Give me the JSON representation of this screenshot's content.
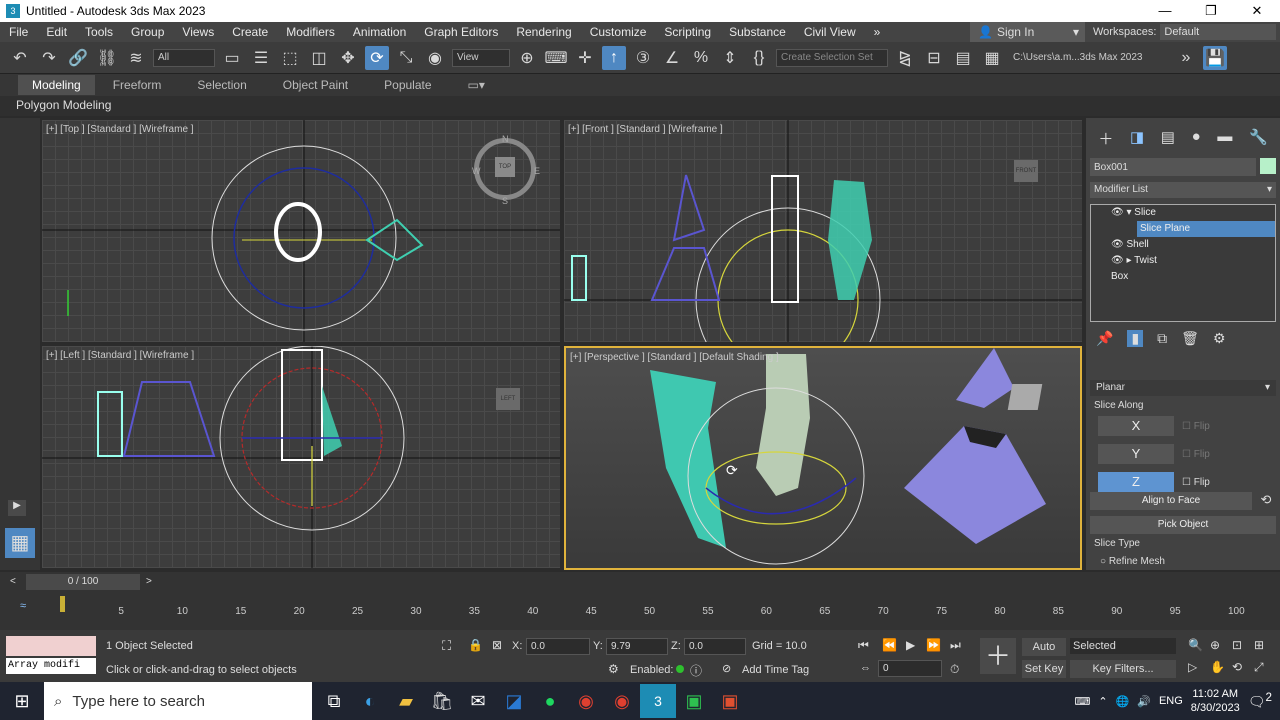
{
  "window": {
    "title": "Untitled - Autodesk 3ds Max 2023",
    "min": "—",
    "max": "❐",
    "close": "✕",
    "app_icon": "3"
  },
  "menu": {
    "items": [
      "File",
      "Edit",
      "Tools",
      "Group",
      "Views",
      "Create",
      "Modifiers",
      "Animation",
      "Graph Editors",
      "Rendering",
      "Customize",
      "Scripting",
      "Substance",
      "Civil View"
    ],
    "overflow": "»",
    "signin": "Sign In",
    "workspaces_label": "Workspaces:",
    "workspaces_value": "Default"
  },
  "toolbar": {
    "filter": "All",
    "coord": "View",
    "selection_set": "Create Selection Set",
    "path": "C:\\Users\\a.m...3ds Max 2023"
  },
  "ribbon": {
    "tabs": [
      "Modeling",
      "Freeform",
      "Selection",
      "Object Paint",
      "Populate"
    ],
    "active": "Modeling",
    "sub": "Polygon Modeling"
  },
  "viewports": {
    "top": "[+] [Top ] [Standard ] [Wireframe ]",
    "front": "[+] [Front ] [Standard ] [Wireframe ]",
    "left": "[+] [Left ] [Standard ] [Wireframe ]",
    "persp": "[+] [Perspective ] [Standard ] [Default Shading ]",
    "compass": {
      "n": "N",
      "s": "S",
      "e": "E",
      "w": "W"
    },
    "cube_top": "TOP",
    "cube_front": "FRONT",
    "cube_left": "LEFT"
  },
  "command_panel": {
    "object_name": "Box001",
    "modifier_list": "Modifier List",
    "stack": [
      "Slice",
      "Slice Plane",
      "Shell",
      "Twist",
      "Box"
    ],
    "dropdown": "Planar",
    "slice_along_label": "Slice Along",
    "axes": [
      "X",
      "Y",
      "Z"
    ],
    "active_axis": "Z",
    "flip": "Flip",
    "align_to_face": "Align to Face",
    "pick_object": "Pick Object",
    "slice_type_label": "Slice Type",
    "refine_mesh": "Refine Mesh"
  },
  "timeline": {
    "frame": "0 / 100",
    "ticks": [
      "0",
      "5",
      "10",
      "15",
      "20",
      "25",
      "30",
      "35",
      "40",
      "45",
      "50",
      "55",
      "60",
      "65",
      "70",
      "75",
      "80",
      "85",
      "90",
      "95",
      "100"
    ]
  },
  "status": {
    "maxscript": "Array modifi",
    "selected": "1 Object Selected",
    "prompt": "Click or click-and-drag to select objects",
    "x_label": "X:",
    "x": "0.0",
    "y_label": "Y:",
    "y": "9.79",
    "z_label": "Z:",
    "z": "0.0",
    "grid": "Grid = 10.0",
    "enabled": "Enabled:",
    "add_time_tag": "Add Time Tag",
    "auto_key": "Auto Key",
    "set_key": "Set Key",
    "selected_dd": "Selected",
    "key_filters": "Key Filters...",
    "frame_field": "0"
  },
  "taskbar": {
    "search_placeholder": "Type here to search",
    "time": "11:02 AM",
    "date": "8/30/2023",
    "lang": "ENG",
    "notif": "2"
  },
  "colors": {
    "selection_blue": "#4f88c2",
    "active_viewport": "#e0b33c"
  }
}
